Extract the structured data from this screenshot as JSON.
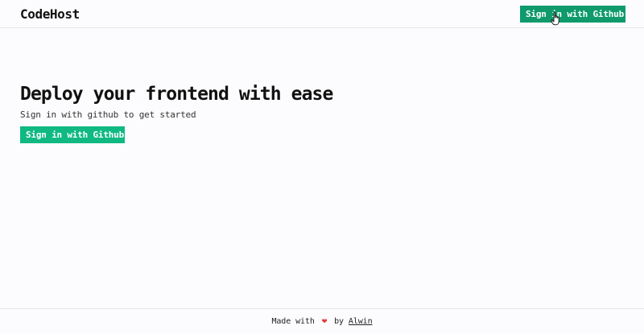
{
  "header": {
    "brand": "CodeHost",
    "signin_label": "Sign in with Github"
  },
  "hero": {
    "title": "Deploy your frontend with ease",
    "subtitle": "Sign in with github to get started",
    "cta_label": "Sign in with Github"
  },
  "footer": {
    "made_with": "Made with",
    "heart_icon": "heart-icon",
    "by": "by",
    "author": "Alwin"
  },
  "colors": {
    "accent": "#10b981",
    "accent_dark": "#0f9a6c",
    "heart": "#e53935",
    "background": "#fcfbfd"
  }
}
